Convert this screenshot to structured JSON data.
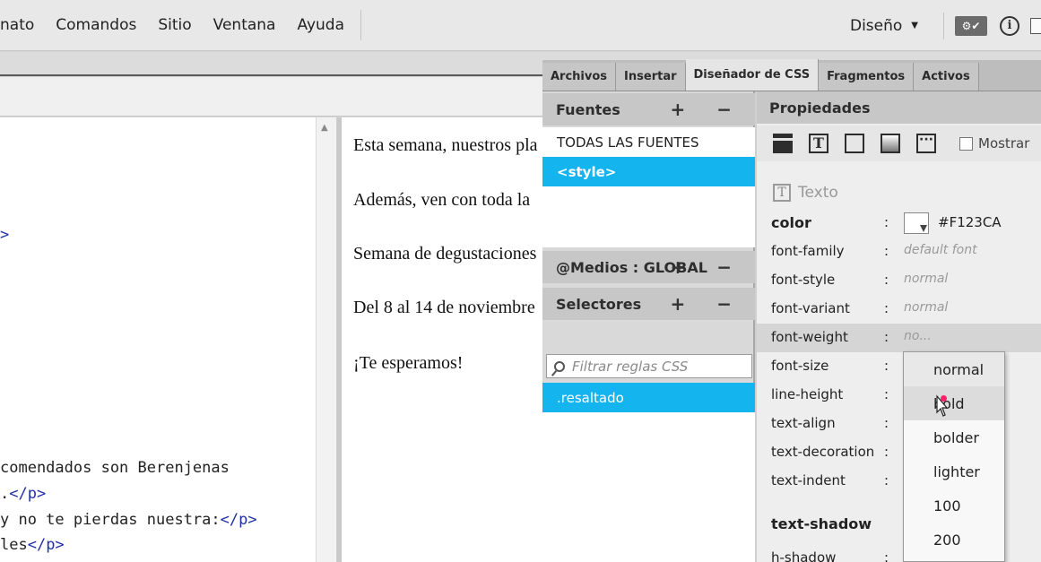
{
  "menu": {
    "items": [
      "nato",
      "Comandos",
      "Sitio",
      "Ventana",
      "Ayuda"
    ],
    "workspace": "Diseño",
    "sync_label": "⚙✔",
    "info_label": "i"
  },
  "code": {
    "lines": [
      {
        "text": ">",
        "tag": true
      },
      {
        "text": "comendados son Berenjenas",
        "tag": false
      },
      {
        "text": ".",
        "tag": false,
        "suffix": "</p>"
      },
      {
        "text": "y no te pierdas nuestra:",
        "tag": false,
        "suffix": "</p>"
      },
      {
        "text": "les",
        "tag": false,
        "suffix": "</p>"
      }
    ]
  },
  "live": {
    "paragraphs": [
      "Esta semana, nuestros pla",
      "Además, ven con toda la",
      "Semana de degustaciones",
      "Del 8 al 14 de noviembre",
      "¡Te esperamos!"
    ]
  },
  "panel": {
    "tabs": [
      "Archivos",
      "Insertar",
      "Diseñador de CSS",
      "Fragmentos",
      "Activos"
    ],
    "active_tab": 2,
    "fuentes": {
      "title": "Fuentes",
      "controls": "+ −",
      "items": [
        "TODAS LAS FUENTES",
        "<style>"
      ],
      "selected": 1
    },
    "medios": {
      "title": "@Medios : GLOBAL",
      "controls": "+ −"
    },
    "selectores": {
      "title": "Selectores",
      "controls": "+ −",
      "filter_placeholder": "Filtrar reglas CSS",
      "items": [
        ".resaltado"
      ]
    },
    "propiedades": {
      "title": "Propiedades",
      "show_label": "Mostrar",
      "section": "Texto",
      "color": {
        "name": "color",
        "hex": "#F123CA"
      },
      "rows": [
        {
          "name": "font-family",
          "value": "default font"
        },
        {
          "name": "font-style",
          "value": "normal"
        },
        {
          "name": "font-variant",
          "value": "normal"
        },
        {
          "name": "font-weight",
          "value": "no..."
        },
        {
          "name": "font-size",
          "value": ""
        },
        {
          "name": "line-height",
          "value": ""
        },
        {
          "name": "text-align",
          "value": ""
        },
        {
          "name": "text-decoration",
          "value": ""
        },
        {
          "name": "text-indent",
          "value": ""
        }
      ],
      "shadow_title": "text-shadow",
      "shadow_row": "h-shadow"
    },
    "font_weight_options": [
      "normal",
      "bold",
      "bolder",
      "lighter",
      "100",
      "200"
    ],
    "hovered_option": 1
  }
}
